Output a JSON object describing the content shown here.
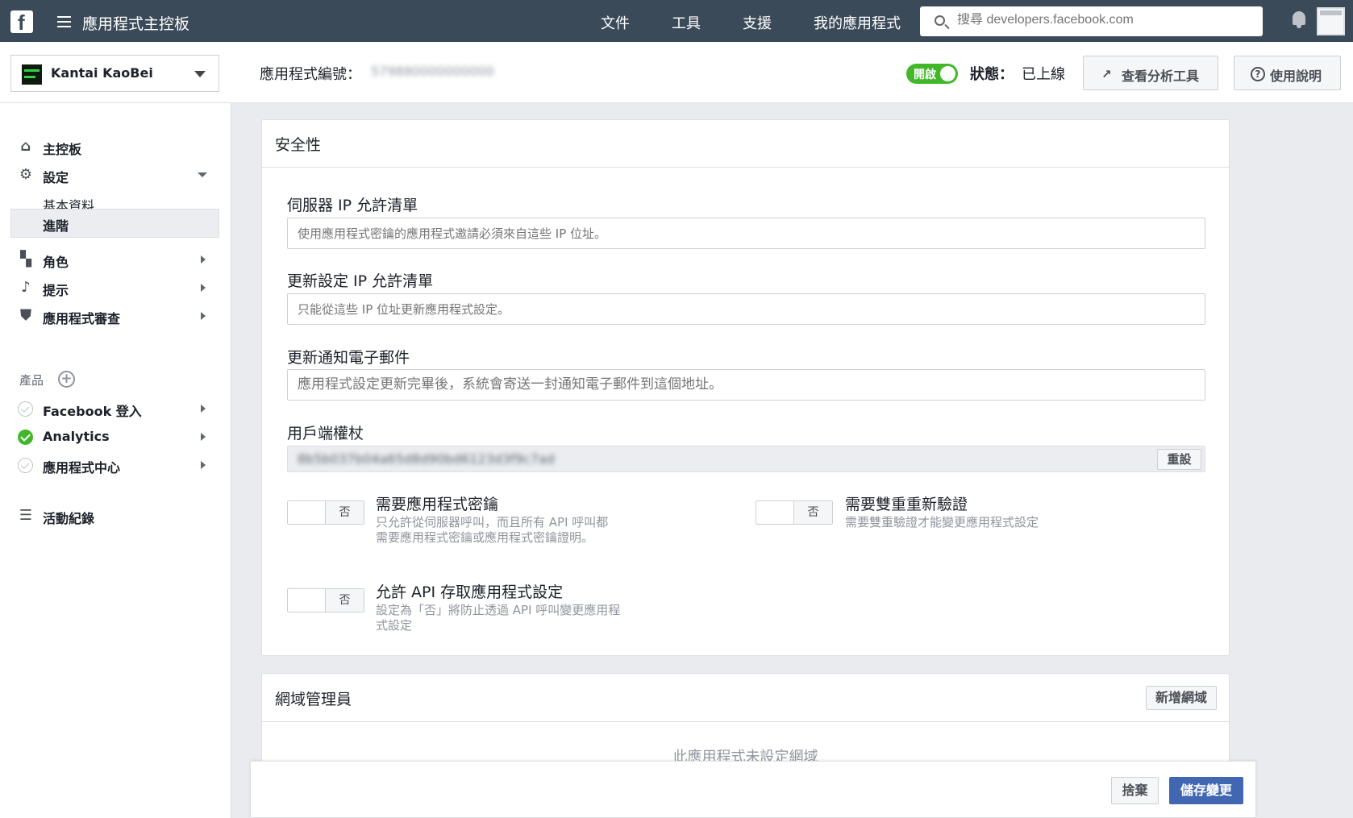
{
  "topbar": {
    "logo_letter": "f",
    "title": "應用程式主控板",
    "nav": [
      "文件",
      "工具",
      "支援",
      "我的應用程式"
    ],
    "search_placeholder": "搜尋 developers.facebook.com"
  },
  "header": {
    "app_name": "Kantai KaoBei",
    "app_id_label": "應用程式編號：",
    "app_id_value": "579880000000000",
    "live_toggle": "開啟",
    "status_label": "狀態：",
    "status_value": "已上線",
    "analytics_button": "查看分析工具",
    "help_button": "使用說明"
  },
  "sidebar": {
    "items": [
      {
        "label": "主控板",
        "icon": "home-icon"
      },
      {
        "label": "設定",
        "icon": "gear-icon"
      },
      {
        "label": "基本資料"
      },
      {
        "label": "進階"
      },
      {
        "label": "角色",
        "icon": "roles-icon"
      },
      {
        "label": "提示",
        "icon": "bell-icon"
      },
      {
        "label": "應用程式審查",
        "icon": "shield-icon"
      }
    ],
    "products_heading": "產品",
    "products": [
      {
        "label": "Facebook 登入",
        "status": "inactive"
      },
      {
        "label": "Analytics",
        "status": "active"
      },
      {
        "label": "應用程式中心",
        "status": "inactive"
      }
    ],
    "activity_log": "活動紀錄"
  },
  "security": {
    "title": "安全性",
    "server_ip_label": "伺服器 IP 允許清單",
    "server_ip_placeholder": "使用應用程式密鑰的應用程式邀請必須來自這些 IP 位址。",
    "update_ip_label": "更新設定 IP 允許清單",
    "update_ip_placeholder": "只能從這些 IP 位址更新應用程式設定。",
    "notify_email_label": "更新通知電子郵件",
    "notify_email_placeholder": "應用程式設定更新完畢後，系統會寄送一封通知電子郵件到這個地址。",
    "client_token_label": "用戶端權杖",
    "client_token_value": "8b5b037b04a65d8d90bd6123d3f9c7ad",
    "reset_button": "重設",
    "options": [
      {
        "title": "需要應用程式密鑰",
        "desc": "只允許從伺服器呼叫，而且所有 API 呼叫都需要應用程式密鑰或應用程式密鑰證明。",
        "state": "否"
      },
      {
        "title": "需要雙重重新驗證",
        "desc": "需要雙重驗證才能變更應用程式設定",
        "state": "否"
      },
      {
        "title": "允許 API 存取應用程式設定",
        "desc": "設定為「否」將防止透過 API 呼叫變更應用程式設定",
        "state": "否"
      }
    ]
  },
  "domain_manager": {
    "title": "網域管理員",
    "add_button": "新增網域",
    "empty_message": "此應用程式未設定網域"
  },
  "footer": {
    "cancel_button": "捨棄",
    "save_button": "儲存變更"
  }
}
